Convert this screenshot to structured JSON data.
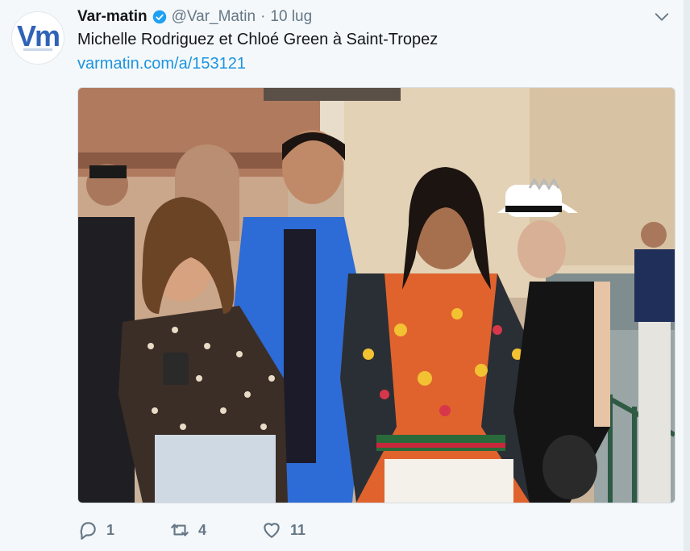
{
  "tweet": {
    "avatar_text": "Vm",
    "author_name": "Var-matin",
    "handle": "@Var_Matin",
    "separator": "·",
    "date": "10 lug",
    "text": "Michelle Rodriguez et Chloé Green à Saint-Tropez",
    "link": "varmatin.com/a/153121"
  },
  "actions": {
    "reply_count": "1",
    "retweet_count": "4",
    "like_count": "11"
  },
  "icons": {
    "verified": "verified-badge-icon",
    "chevron": "chevron-down-icon",
    "reply": "reply-icon",
    "retweet": "retweet-icon",
    "like": "heart-icon"
  },
  "colors": {
    "accent_link": "#1b95e0",
    "verified": "#1da1f2",
    "muted": "#657786",
    "text": "#14171a",
    "background": "#f5f8fa"
  }
}
